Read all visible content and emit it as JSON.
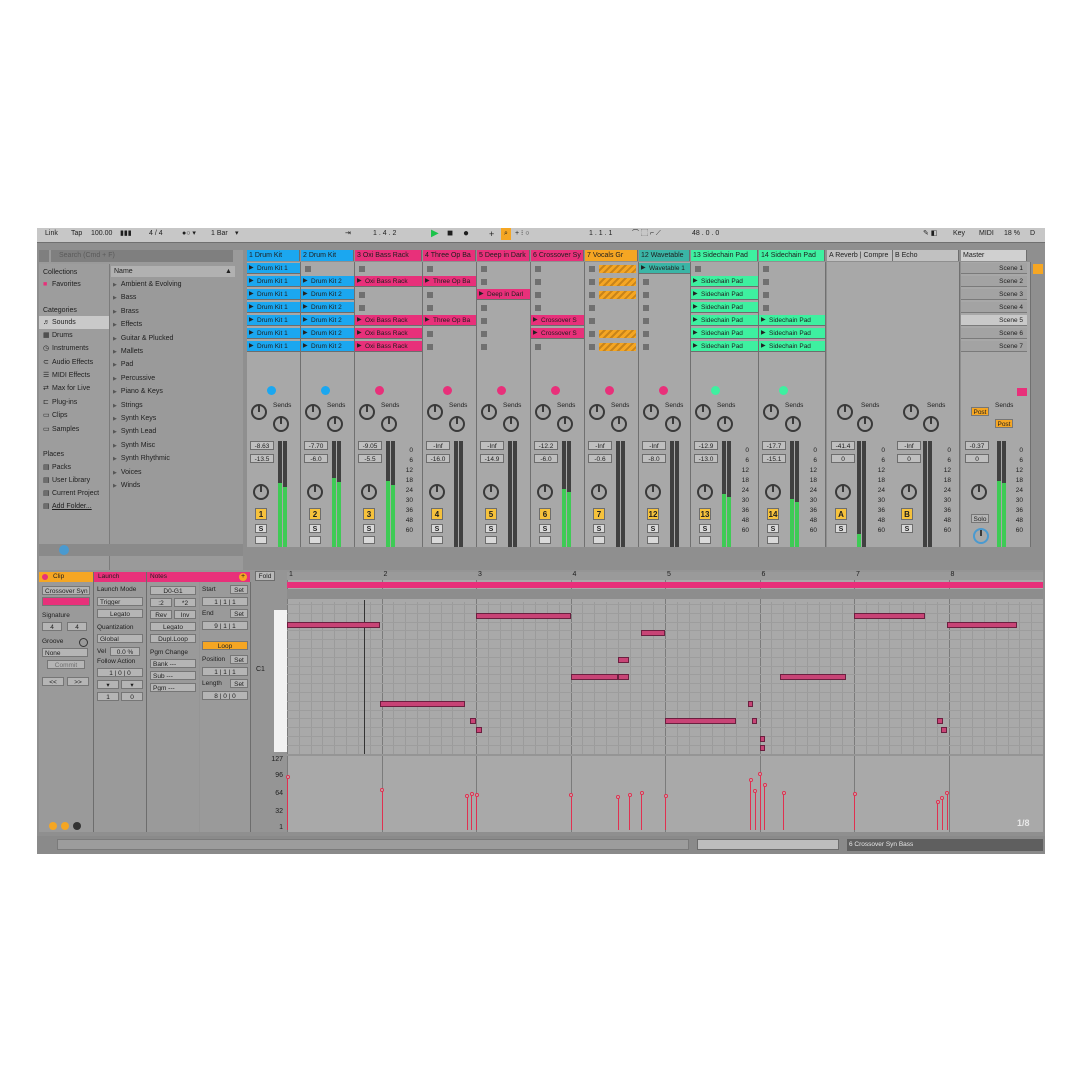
{
  "topbar": {
    "link": "Link",
    "tap": "Tap",
    "tempo": "100.00",
    "signature": "4 / 4",
    "quantize": "1 Bar",
    "arrangement_position": "1 . 4 . 2",
    "loop_start": "1 . 1 . 1",
    "loop_length": "48 . 0 . 0",
    "key": "Key",
    "midi": "MIDI",
    "cpu": "18 %",
    "d": "D"
  },
  "browser": {
    "search_placeholder": "Search (Cmd + F)",
    "collections_label": "Collections",
    "favorites": "Favorites",
    "categories_label": "Categories",
    "categories": [
      "Sounds",
      "Drums",
      "Instruments",
      "Audio Effects",
      "MIDI Effects",
      "Max for Live",
      "Plug-ins",
      "Clips",
      "Samples"
    ],
    "places_label": "Places",
    "places": [
      "Packs",
      "User Library",
      "Current Project",
      "Add Folder..."
    ],
    "name_header": "Name",
    "items": [
      "Ambient & Evolving",
      "Bass",
      "Brass",
      "Effects",
      "Guitar & Plucked",
      "Mallets",
      "Pad",
      "Percussive",
      "Piano & Keys",
      "Strings",
      "Synth Keys",
      "Synth Lead",
      "Synth Misc",
      "Synth Rhythmic",
      "Voices",
      "Winds"
    ]
  },
  "tracks": [
    {
      "name": "1 Drum Kit",
      "color": "#1ba7f0",
      "num": "1",
      "vol": "-8.63",
      "vol2": "-13.5",
      "clips": [
        "Drum Kit 1",
        "Drum Kit 1",
        "Drum Kit 1",
        "Drum Kit 1",
        "Drum Kit 1",
        "Drum Kit 1",
        "Drum Kit 1"
      ]
    },
    {
      "name": "2 Drum Kit",
      "color": "#1ba7f0",
      "num": "2",
      "vol": "-7.70",
      "vol2": "-6.0",
      "clips": [
        "",
        "Drum Kit 2",
        "Drum Kit 2",
        "Drum Kit 2",
        "Drum Kit 2",
        "Drum Kit 2",
        "Drum Kit 2"
      ]
    },
    {
      "name": "3 Oxi Bass Rack",
      "color": "#e8307a",
      "num": "3",
      "vol": "-9.05",
      "vol2": "-5.5",
      "clips": [
        "",
        "Oxi Bass Rack",
        "",
        "",
        "Oxi Bass Rack",
        "Oxi Bass Rack",
        "Oxi Bass Rack"
      ]
    },
    {
      "name": "4 Three Op Ba",
      "color": "#e8307a",
      "num": "4",
      "vol": "-Inf",
      "vol2": "-16.0",
      "clips": [
        "",
        "Three Op Ba",
        "",
        "",
        "Three Op Ba",
        "",
        ""
      ]
    },
    {
      "name": "5 Deep in Dark",
      "color": "#e8307a",
      "num": "5",
      "vol": "-Inf",
      "vol2": "-14.9",
      "clips": [
        "",
        "",
        "Deep in Darl",
        "",
        "",
        "",
        ""
      ]
    },
    {
      "name": "6 Crossover Sy",
      "color": "#e8307a",
      "num": "6",
      "vol": "-12.2",
      "vol2": "-6.0",
      "clips": [
        "",
        "",
        "",
        "",
        "Crossover S",
        "Crossover S",
        ""
      ]
    },
    {
      "name": "7 Vocals Gr",
      "color": "#f5a623",
      "num": "7",
      "vol": "-Inf",
      "vol2": "-0.6",
      "clips": [
        "",
        "",
        "",
        "",
        "",
        "",
        ""
      ]
    },
    {
      "name": "12 Wavetable",
      "color": "#3ab5a6",
      "num": "12",
      "vol": "-Inf",
      "vol2": "-8.0",
      "clips": [
        "Wavetable 1",
        "",
        "",
        "",
        "",
        "",
        ""
      ]
    },
    {
      "name": "13 Sidechain Pad",
      "color": "#3ef0a0",
      "num": "13",
      "vol": "-12.9",
      "vol2": "-13.0",
      "clips": [
        "",
        "Sidechain Pad",
        "Sidechain Pad",
        "Sidechain Pad",
        "Sidechain Pad",
        "Sidechain Pad",
        "Sidechain Pad"
      ]
    },
    {
      "name": "14 Sidechain Pad",
      "color": "#3ef0a0",
      "num": "14",
      "vol": "-17.7",
      "vol2": "-15.1",
      "clips": [
        "",
        "",
        "",
        "",
        "Sidechain Pad",
        "Sidechain Pad",
        "Sidechain Pad"
      ]
    }
  ],
  "returns": [
    {
      "name": "A Reverb | Compre",
      "num": "A",
      "vol": "-41.4",
      "vol2": "0"
    },
    {
      "name": "B Echo",
      "num": "B",
      "vol": "-Inf",
      "vol2": "0"
    }
  ],
  "master": {
    "name": "Master",
    "vol": "-0.37",
    "vol2": "0",
    "post": "Post",
    "solo": "Solo"
  },
  "scenes": [
    "Scene 1",
    "Scene 2",
    "Scene 3",
    "Scene 4",
    "Scene 5",
    "Scene 6",
    "Scene 7"
  ],
  "sends_label": "Sends",
  "db_scale": [
    "0",
    "6",
    "12",
    "18",
    "24",
    "30",
    "36",
    "48",
    "60"
  ],
  "clip_view": {
    "clip_tab": "Clip",
    "launch_tab": "Launch",
    "notes_tab": "Notes",
    "clip_name": "Crossover Syn",
    "signature_label": "Signature",
    "sig_num": "4",
    "sig_den": "4",
    "groove_label": "Groove",
    "groove_value": "None",
    "commit": "Commit",
    "launch_mode_label": "Launch Mode",
    "launch_mode": "Trigger",
    "legato": "Legato",
    "quantization_label": "Quantization",
    "quantization": "Global",
    "vel_label": "Vel",
    "vel_value": "0.0 %",
    "follow_label": "Follow Action",
    "note_range": "D0-G1",
    "div2": ":2",
    "mul2": "*2",
    "rev": "Rev",
    "inv": "Inv",
    "notes_legato": "Legato",
    "dupl_loop": "Dupl.Loop",
    "pgm_change_label": "Pgm Change",
    "bank": "Bank ---",
    "sub": "Sub ---",
    "pgm": "Pgm ---",
    "start_label": "Start",
    "end_label": "End",
    "set": "Set",
    "loop": "Loop",
    "position_label": "Position",
    "length_label": "Length",
    "start": [
      "1",
      "1",
      "1"
    ],
    "end": [
      "9",
      "1",
      "1"
    ],
    "position": [
      "1",
      "1",
      "1"
    ],
    "length": [
      "8",
      "0",
      "0"
    ],
    "nav_prev": "<<",
    "nav_next": ">>"
  },
  "piano_roll": {
    "fold": "Fold",
    "c1_label": "C1",
    "bars": [
      "1",
      "2",
      "3",
      "4",
      "5",
      "6",
      "7",
      "8"
    ],
    "vel_scale": [
      "127",
      "96",
      "64",
      "32",
      "1"
    ],
    "grid": "1/8",
    "notes": [
      {
        "start": 0.0,
        "len": 0.98,
        "pitch": 14
      },
      {
        "start": 0.98,
        "len": 0.9,
        "pitch": 5
      },
      {
        "start": 2.0,
        "len": 1.0,
        "pitch": 15
      },
      {
        "start": 2.0,
        "len": 0.06,
        "pitch": 2
      },
      {
        "start": 1.94,
        "len": 0.06,
        "pitch": 3
      },
      {
        "start": 3.0,
        "len": 0.5,
        "pitch": 8
      },
      {
        "start": 3.5,
        "len": 0.12,
        "pitch": 8
      },
      {
        "start": 3.5,
        "len": 0.12,
        "pitch": 10
      },
      {
        "start": 3.75,
        "len": 0.25,
        "pitch": 13
      },
      {
        "start": 4.0,
        "len": 0.75,
        "pitch": 3
      },
      {
        "start": 4.92,
        "len": 0.04,
        "pitch": 3
      },
      {
        "start": 4.88,
        "len": 0.04,
        "pitch": 5
      },
      {
        "start": 5.0,
        "len": 0.06,
        "pitch": 1
      },
      {
        "start": 5.0,
        "len": 0.06,
        "pitch": 0
      },
      {
        "start": 5.22,
        "len": 0.7,
        "pitch": 8
      },
      {
        "start": 6.0,
        "len": 0.75,
        "pitch": 15
      },
      {
        "start": 6.88,
        "len": 0.06,
        "pitch": 3
      },
      {
        "start": 6.92,
        "len": 0.06,
        "pitch": 2
      },
      {
        "start": 6.98,
        "len": 0.75,
        "pitch": 14
      }
    ],
    "velocities": [
      {
        "pos": 0.0,
        "vel": 96
      },
      {
        "pos": 1.0,
        "vel": 72
      },
      {
        "pos": 1.9,
        "vel": 62
      },
      {
        "pos": 1.95,
        "vel": 66
      },
      {
        "pos": 2.0,
        "vel": 64
      },
      {
        "pos": 3.0,
        "vel": 64
      },
      {
        "pos": 3.5,
        "vel": 60
      },
      {
        "pos": 3.62,
        "vel": 64
      },
      {
        "pos": 3.75,
        "vel": 68
      },
      {
        "pos": 4.0,
        "vel": 62
      },
      {
        "pos": 4.9,
        "vel": 90
      },
      {
        "pos": 4.95,
        "vel": 70
      },
      {
        "pos": 5.0,
        "vel": 102
      },
      {
        "pos": 5.05,
        "vel": 82
      },
      {
        "pos": 5.25,
        "vel": 68
      },
      {
        "pos": 6.0,
        "vel": 66
      },
      {
        "pos": 6.88,
        "vel": 50
      },
      {
        "pos": 6.93,
        "vel": 58
      },
      {
        "pos": 6.98,
        "vel": 68
      }
    ]
  },
  "status": {
    "device": "6 Crossover Syn Bass"
  }
}
